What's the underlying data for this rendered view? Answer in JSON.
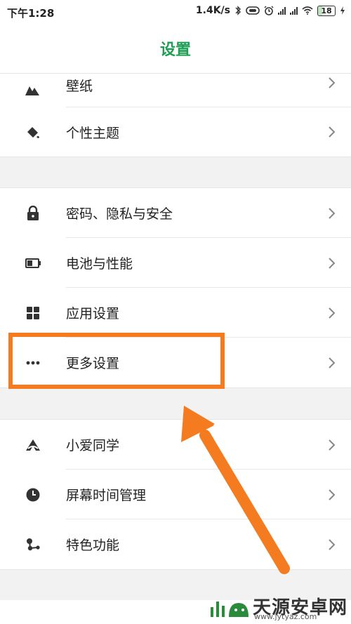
{
  "status_bar": {
    "time": "下午1:28",
    "speed": "1.4K/s",
    "battery": "18"
  },
  "header": {
    "title": "设置"
  },
  "groups": [
    {
      "items": [
        {
          "label": "壁纸",
          "icon": "wallpaper-icon"
        },
        {
          "label": "个性主题",
          "icon": "theme-brush-icon"
        }
      ]
    },
    {
      "items": [
        {
          "label": "密码、隐私与安全",
          "icon": "lock-icon"
        },
        {
          "label": "电池与性能",
          "icon": "battery-icon"
        },
        {
          "label": "应用设置",
          "icon": "apps-grid-icon"
        },
        {
          "label": "更多设置",
          "icon": "more-dots-icon"
        }
      ]
    },
    {
      "items": [
        {
          "label": "小爱同学",
          "icon": "xiaoai-icon"
        },
        {
          "label": "屏幕时间管理",
          "icon": "clock-icon"
        },
        {
          "label": "特色功能",
          "icon": "features-icon"
        }
      ]
    }
  ],
  "annotation": {
    "color": "#f47b20"
  },
  "watermark": {
    "text": "天源安卓网",
    "url": "www.jytyaz.com"
  },
  "colors": {
    "accent": "#1e9e54",
    "background": "#f2f2f2"
  }
}
